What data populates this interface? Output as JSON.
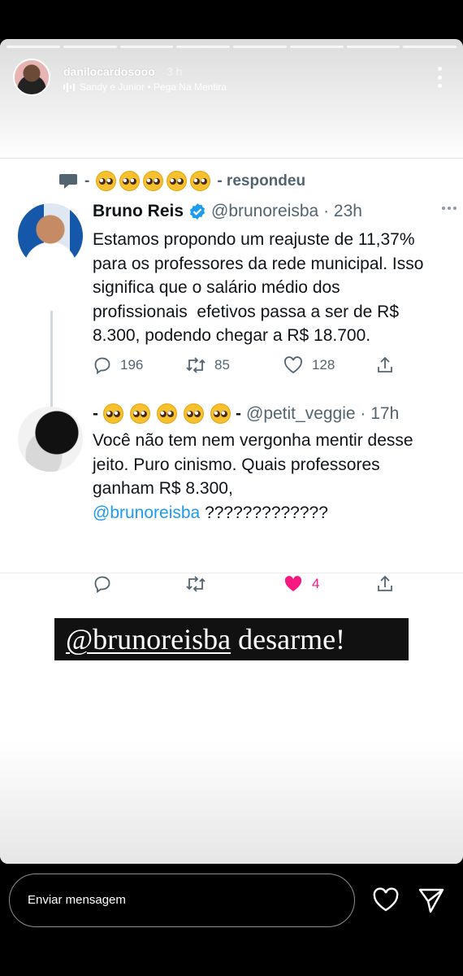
{
  "story": {
    "username": "danilocardosooo",
    "time": "3 h",
    "music": "Sandy e Junior • Pega Na Mentira",
    "progress_segments": 8
  },
  "reply_header": {
    "prefix": "-",
    "emoji_count": 5,
    "suffix": "- respondeu"
  },
  "tweet1": {
    "name": "Bruno Reis",
    "handle": "@brunoreisba · 23h",
    "text": "Estamos propondo um reajuste de 11,37%\npara os professores da rede municipal. Isso\nsignifica que o salário médio dos\nprofissionais  efetivos passa a ser de R$\n8.300, podendo chegar a R$ 18.700.",
    "replies": "196",
    "retweets": "85",
    "likes": "128"
  },
  "tweet2": {
    "name_prefix": "-",
    "emoji_count": 5,
    "name_suffix": "-",
    "handle": "@petit_veggie · 17h",
    "text": "Você não tem nem vergonha mentir desse\njeito. Puro cinismo. Quais professores\nganham R$ 8.300,",
    "mention": "@brunoreisba",
    "text_end": " ?????????????",
    "likes": "4"
  },
  "caption": {
    "mention": "@brunoreisba",
    "text": " desarme!"
  },
  "bottom": {
    "message_placeholder": "Enviar mensagem"
  },
  "colors": {
    "twitter_blue": "#1d9bf0",
    "like_pink": "#f91880",
    "secondary_text": "#536471"
  }
}
